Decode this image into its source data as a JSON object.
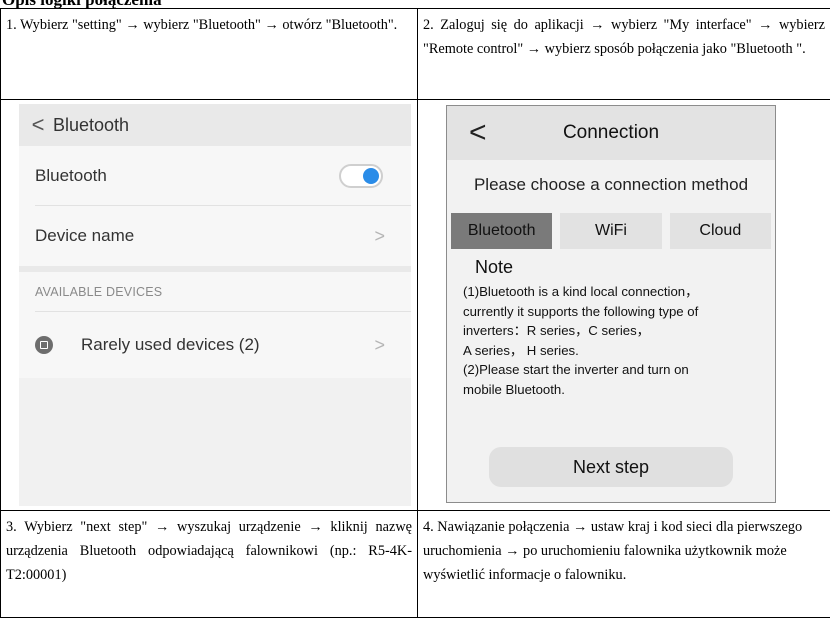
{
  "heading": "Opis logiki połączenia",
  "steps": {
    "s1": "1. Wybierz \"setting\" → wybierz \"Bluetooth\" → otwórz \"Bluetooth\".",
    "s2": "2. Zaloguj się do aplikacji → wybierz \"My interface\" → wybierz \"Remote control\" → wybierz sposób połączenia jako \"Bluetooth \".",
    "s3": "3. Wybierz \"next step\" → wyszukaj urządzenie → kliknij nazwę urządzenia Bluetooth odpowiadającą falownikowi (np.: R5-4K-T2:00001)",
    "s4": "4. Nawiązanie połączenia → ustaw kraj i kod sieci dla pierwszego uruchomienia → po uruchomieniu falownika użytkownik może wyświetlić informacje o falowniku."
  },
  "left_screen": {
    "back_glyph": "<",
    "title": "Bluetooth",
    "bluetooth_label": "Bluetooth",
    "bluetooth_on": true,
    "device_name_label": "Device name",
    "available_header": "AVAILABLE DEVICES",
    "rarely_used_label": "Rarely used devices (2)",
    "chevron": ">",
    "toggle_color": "#2a8ce8"
  },
  "right_screen": {
    "back_glyph": "<",
    "title": "Connection",
    "prompt": "Please choose a connection method",
    "tabs": [
      "Bluetooth",
      "WiFi",
      "Cloud"
    ],
    "active_tab": "Bluetooth",
    "note_title": "Note",
    "note_lines": [
      "(1)Bluetooth is a kind local connection，",
      "currently it supports the following type of",
      "inverters：R series，C series，",
      "A series， H series.",
      "(2)Please start the inverter and turn on",
      "mobile Bluetooth."
    ],
    "next_button": "Next step"
  }
}
